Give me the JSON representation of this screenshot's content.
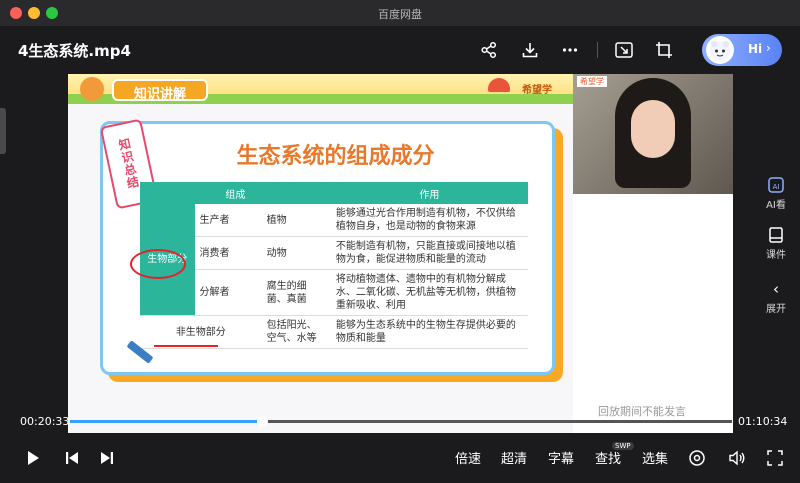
{
  "window": {
    "title": "百度网盘"
  },
  "header": {
    "filename": "4生态系统.mp4",
    "hi_label": "Hi"
  },
  "banner": {
    "badge": "知识讲解",
    "sub": "希望学"
  },
  "slide": {
    "tag": "知识总结",
    "title": "生态系统的组成成分",
    "table": {
      "headers": [
        "组成",
        "作用"
      ],
      "group_label": "生物部分",
      "rows": [
        {
          "role": "生产者",
          "example": "植物",
          "function": "能够通过光合作用制造有机物，不仅供给植物自身，也是动物的食物来源"
        },
        {
          "role": "消费者",
          "example": "动物",
          "function": "不能制造有机物，只能直接或间接地以植物为食，能促进物质和能量的流动"
        },
        {
          "role": "分解者",
          "example": "腐生的细菌、真菌",
          "function": "将动植物遗体、遗物中的有机物分解成水、二氧化碳、无机盐等无机物，供植物重新吸收、利用"
        }
      ],
      "nonliving": {
        "label": "非生物部分",
        "example": "包括阳光、空气、水等",
        "function": "能够为生态系统中的生物生存提供必要的物质和能量"
      }
    },
    "notice": "回放期间不能发言"
  },
  "webcam": {
    "label": "希望学"
  },
  "right_panel": {
    "ai": "AI看",
    "lessons": "课件",
    "expand": "展开"
  },
  "player": {
    "current_time": "00:20:33",
    "total_time": "01:10:34",
    "progress": 0.29,
    "speed": "倍速",
    "quality": "超清",
    "subtitle": "字幕",
    "search": "查找",
    "search_badge": "SWP",
    "episodes": "选集"
  },
  "colors": {
    "accent": "#3aa0ff",
    "table_green": "#2bb59b",
    "title_orange": "#e8782a"
  }
}
